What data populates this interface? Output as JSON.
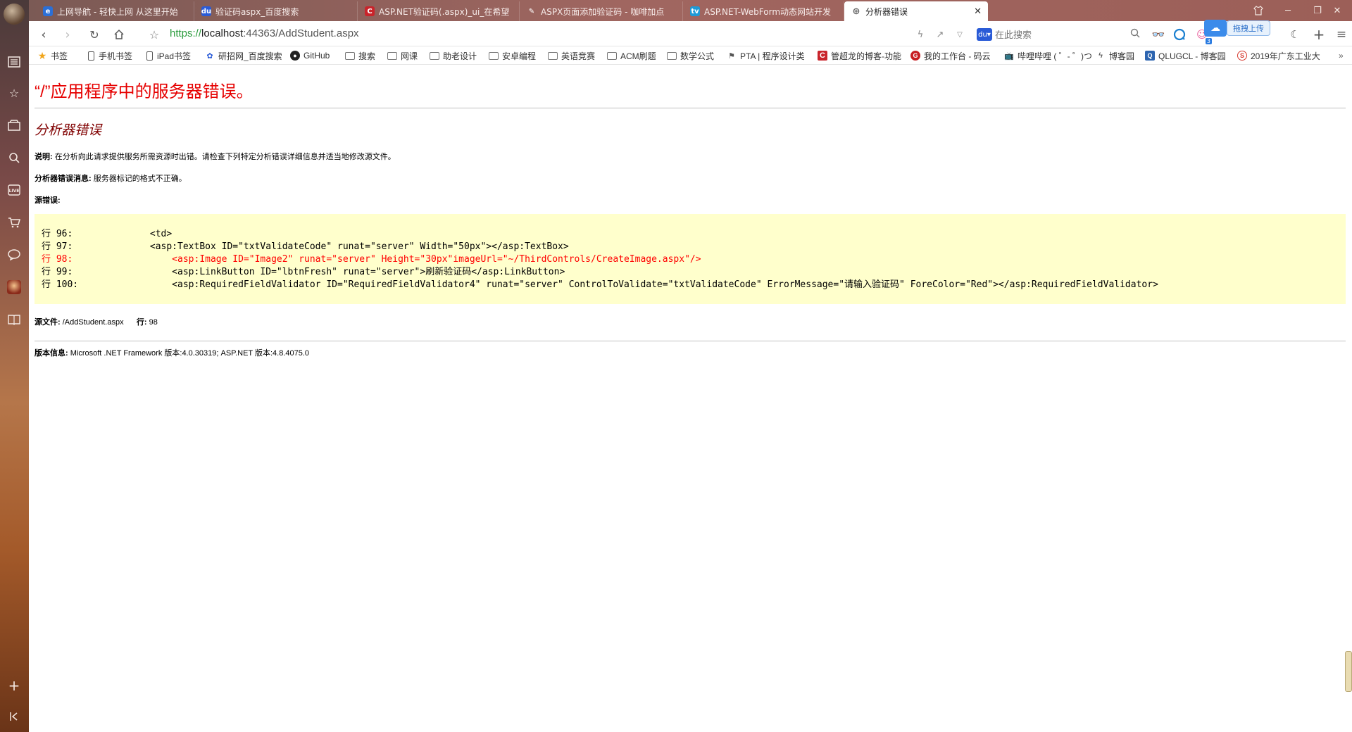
{
  "tabs": [
    {
      "label": "上网导航 - 轻快上网 从这里开始",
      "icon": "e-icon",
      "color": "#2b6fd6"
    },
    {
      "label": "验证码aspx_百度搜索",
      "icon": "baidu-icon",
      "color": "#2a5bd7"
    },
    {
      "label": "ASP.NET验证码(.aspx)_ui_在希望",
      "icon": "csdn-icon",
      "color": "#c9242b"
    },
    {
      "label": "ASPX页面添加验证码 - 咖啡加点",
      "icon": "jianshu-icon",
      "color": "#777777"
    },
    {
      "label": "ASP.NET-WebForm动态网站开发",
      "icon": "bilibili-icon",
      "color": "#1d9ad6"
    },
    {
      "label": "分析器错误",
      "icon": "globe-icon",
      "color": "#666666",
      "active": true
    }
  ],
  "address": {
    "proto": "https://",
    "host": "localhost",
    "path": ":44363/AddStudent.aspx"
  },
  "search": {
    "placeholder": "在此搜索"
  },
  "toolbar": {
    "badge_count": "3",
    "upload_label": "拖拽上传"
  },
  "bookmarks": [
    {
      "label": "书签",
      "type": "star"
    },
    {
      "label": "手机书签",
      "type": "phone"
    },
    {
      "label": "iPad书签",
      "type": "phone"
    },
    {
      "label": "研招网_百度搜索",
      "type": "baidu"
    },
    {
      "label": "GitHub",
      "type": "github"
    },
    {
      "label": "搜索",
      "type": "folder"
    },
    {
      "label": "网课",
      "type": "folder"
    },
    {
      "label": "助老设计",
      "type": "folder"
    },
    {
      "label": "安卓编程",
      "type": "folder"
    },
    {
      "label": "英语竞赛",
      "type": "folder"
    },
    {
      "label": "ACM刷题",
      "type": "folder"
    },
    {
      "label": "数学公式",
      "type": "folder"
    },
    {
      "label": "PTA | 程序设计类",
      "type": "pta"
    },
    {
      "label": "管超龙的博客-功能",
      "type": "csdn"
    },
    {
      "label": "我的工作台 - 码云",
      "type": "gitee"
    },
    {
      "label": "哔哩哔哩 ( ゜- ゜)つ",
      "type": "bilibili"
    },
    {
      "label": "博客园",
      "type": "cnblogs"
    },
    {
      "label": "QLUGCL - 博客园",
      "type": "qlu"
    },
    {
      "label": "2019年广东工业大",
      "type": "s"
    }
  ],
  "page": {
    "title": "“/”应用程序中的服务器错误。",
    "error_heading": "分析器错误",
    "description_label": "说明:",
    "description_text": "在分析向此请求提供服务所需资源时出错。请检查下列特定分析错误详细信息并适当地修改源文件。",
    "parser_msg_label": "分析器错误消息:",
    "parser_msg_text": "服务器标记的格式不正确。",
    "source_error_label": "源错误:",
    "code_lines": [
      {
        "text": "行 96:              <td>",
        "error": false
      },
      {
        "text": "行 97:              <asp:TextBox ID=\"txtValidateCode\" runat=\"server\" Width=\"50px\"></asp:TextBox>",
        "error": false
      },
      {
        "text": "行 98:                  <asp:Image ID=\"Image2\" runat=\"server\" Height=\"30px\"imageUrl=\"~/ThirdControls/CreateImage.aspx\"/>",
        "error": true
      },
      {
        "text": "行 99:                  <asp:LinkButton ID=\"lbtnFresh\" runat=\"server\">刷新验证码</asp:LinkButton>",
        "error": false
      },
      {
        "text": "行 100:                 <asp:RequiredFieldValidator ID=\"RequiredFieldValidator4\" runat=\"server\" ControlToValidate=\"txtValidateCode\" ErrorMessage=\"请输入验证码\" ForeColor=\"Red\"></asp:RequiredFieldValidator>",
        "error": false
      }
    ],
    "source_file_label": "源文件:",
    "source_file_value": "/AddStudent.aspx",
    "line_label": "行:",
    "line_value": "98",
    "version_label": "版本信息:",
    "version_text": "Microsoft .NET Framework 版本:4.0.30319; ASP.NET 版本:4.8.4075.0"
  }
}
